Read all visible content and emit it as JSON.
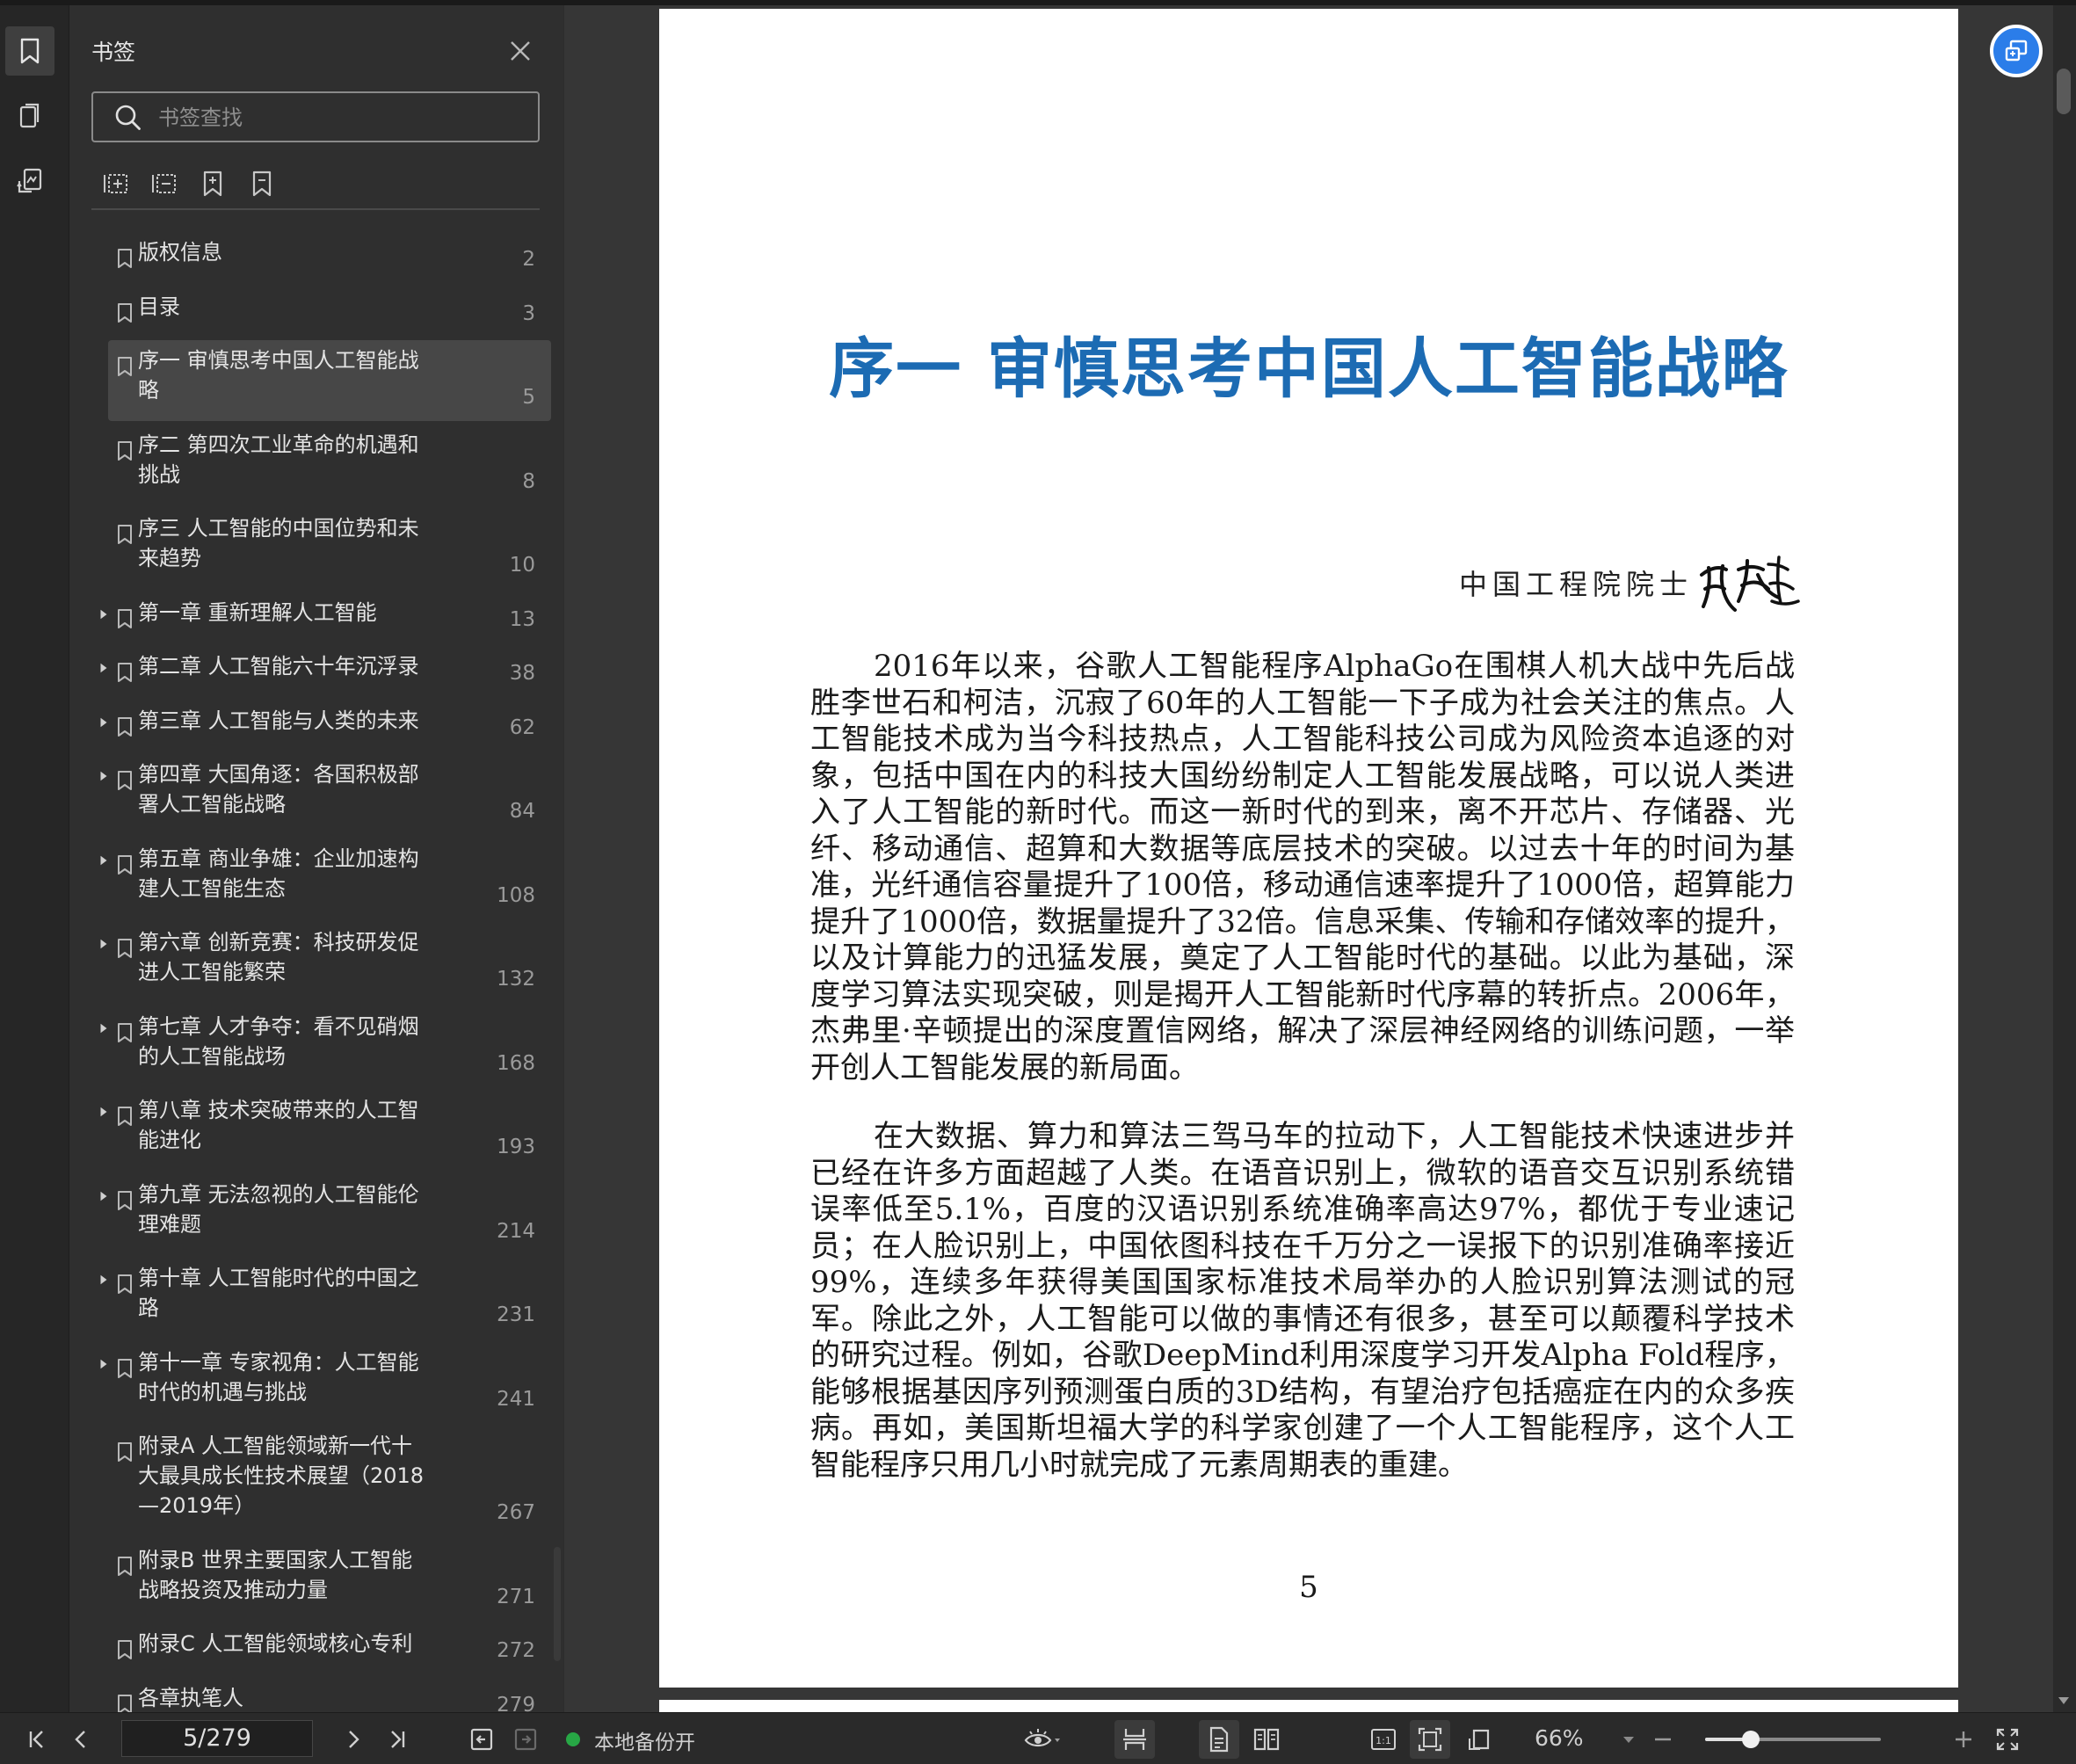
{
  "panel": {
    "title": "书签",
    "search_placeholder": "书签查找"
  },
  "bookmarks": [
    {
      "label": "版权信息",
      "page": "2",
      "expandable": false,
      "active": false
    },
    {
      "label": "目录",
      "page": "3",
      "expandable": false,
      "active": false
    },
    {
      "label": "序一 审慎思考中国人工智能战\n略",
      "page": "5",
      "expandable": false,
      "active": true
    },
    {
      "label": "序二 第四次工业革命的机遇和\n挑战",
      "page": "8",
      "expandable": false,
      "active": false
    },
    {
      "label": "序三 人工智能的中国位势和未\n来趋势",
      "page": "10",
      "expandable": false,
      "active": false
    },
    {
      "label": "第一章 重新理解人工智能",
      "page": "13",
      "expandable": true,
      "active": false
    },
    {
      "label": "第二章 人工智能六十年沉浮录",
      "page": "38",
      "expandable": true,
      "active": false
    },
    {
      "label": "第三章 人工智能与人类的未来",
      "page": "62",
      "expandable": true,
      "active": false
    },
    {
      "label": "第四章 大国角逐：各国积极部\n署人工智能战略",
      "page": "84",
      "expandable": true,
      "active": false
    },
    {
      "label": "第五章 商业争雄：企业加速构\n建人工智能生态",
      "page": "108",
      "expandable": true,
      "active": false
    },
    {
      "label": "第六章 创新竞赛：科技研发促\n进人工智能繁荣",
      "page": "132",
      "expandable": true,
      "active": false
    },
    {
      "label": "第七章 人才争夺：看不见硝烟\n的人工智能战场",
      "page": "168",
      "expandable": true,
      "active": false
    },
    {
      "label": "第八章 技术突破带来的人工智\n能进化",
      "page": "193",
      "expandable": true,
      "active": false
    },
    {
      "label": "第九章 无法忽视的人工智能伦\n理难题",
      "page": "214",
      "expandable": true,
      "active": false
    },
    {
      "label": "第十章 人工智能时代的中国之\n路",
      "page": "231",
      "expandable": true,
      "active": false
    },
    {
      "label": "第十一章 专家视角：人工智能\n时代的机遇与挑战",
      "page": "241",
      "expandable": true,
      "active": false
    },
    {
      "label": "附录A 人工智能领域新一代十\n大最具成长性技术展望（2018\n—2019年）",
      "page": "267",
      "expandable": false,
      "active": false
    },
    {
      "label": "附录B 世界主要国家人工智能\n战略投资及推动力量",
      "page": "271",
      "expandable": false,
      "active": false
    },
    {
      "label": "附录C 人工智能领域核心专利",
      "page": "272",
      "expandable": false,
      "active": false
    },
    {
      "label": "各章执笔人",
      "page": "279",
      "expandable": false,
      "active": false
    }
  ],
  "document": {
    "chapter_title": "序一  审慎思考中国人工智能战略",
    "author_line": "中国工程院院士",
    "signature_name": "邬贺铨",
    "paragraphs": [
      "2016年以来，谷歌人工智能程序AlphaGo在围棋人机大战中先后战胜李世石和柯洁，沉寂了60年的人工智能一下子成为社会关注的焦点。人工智能技术成为当今科技热点，人工智能科技公司成为风险资本追逐的对象，包括中国在内的科技大国纷纷制定人工智能发展战略，可以说人类进入了人工智能的新时代。而这一新时代的到来，离不开芯片、存储器、光纤、移动通信、超算和大数据等底层技术的突破。以过去十年的时间为基准，光纤通信容量提升了100倍，移动通信速率提升了1000倍，超算能力提升了1000倍，数据量提升了32倍。信息采集、传输和存储效率的提升，以及计算能力的迅猛发展，奠定了人工智能时代的基础。以此为基础，深度学习算法实现突破，则是揭开人工智能新时代序幕的转折点。2006年，杰弗里·辛顿提出的深度置信网络，解决了深层神经网络的训练问题，一举开创人工智能发展的新局面。",
      "在大数据、算力和算法三驾马车的拉动下，人工智能技术快速进步并已经在许多方面超越了人类。在语音识别上，微软的语音交互识别系统错误率低至5.1%，百度的汉语识别系统准确率高达97%，都优于专业速记员；在人脸识别上，中国依图科技在千万分之一误报下的识别准确率接近99%，连续多年获得美国国家标准技术局举办的人脸识别算法测试的冠军。除此之外，人工智能可以做的事情还有很多，甚至可以颠覆科学技术的研究过程。例如，谷歌DeepMind利用深度学习开发Alpha Fold程序，能够根据基因序列预测蛋白质的3D结构，有望治疗包括癌症在内的众多疾病。再如，美国斯坦福大学的科学家创建了一个人工智能程序，这个人工智能程序只用几小时就完成了元素周期表的重建。"
    ],
    "page_number": "5"
  },
  "status_bar": {
    "page_field": "5/279",
    "backup_label": "本地备份开",
    "zoom_label": "66%",
    "zoom_fraction": 0.26
  },
  "colors": {
    "title_blue": "#1c6bb3",
    "accent_blue": "#2b7de9",
    "backup_green": "#27a745"
  }
}
